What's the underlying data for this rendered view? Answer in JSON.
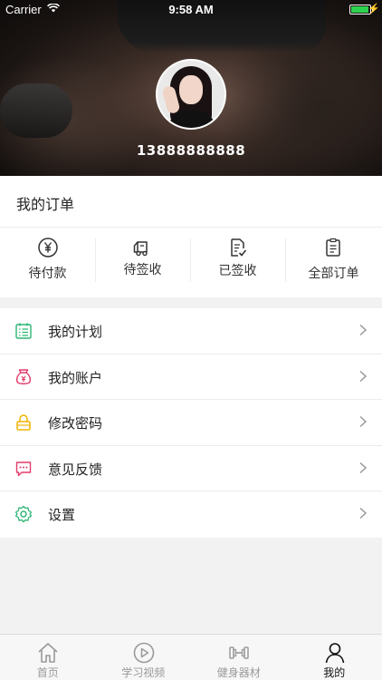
{
  "status_bar": {
    "carrier": "Carrier",
    "time": "9:58 AM"
  },
  "profile": {
    "phone": "13888888888"
  },
  "orders": {
    "title": "我的订单",
    "items": [
      {
        "label": "待付款",
        "icon": "yen-circle-icon"
      },
      {
        "label": "待签收",
        "icon": "delivery-truck-icon"
      },
      {
        "label": "已签收",
        "icon": "signed-document-icon"
      },
      {
        "label": "全部订单",
        "icon": "clipboard-list-icon"
      }
    ]
  },
  "menu": [
    {
      "label": "我的计划",
      "icon": "plan-list-icon",
      "color": "#2bb673"
    },
    {
      "label": "我的账户",
      "icon": "money-bag-icon",
      "color": "#e23c6b"
    },
    {
      "label": "修改密码",
      "icon": "lock-icon",
      "color": "#f0b400"
    },
    {
      "label": "意见反馈",
      "icon": "chat-bubble-icon",
      "color": "#e23c6b"
    },
    {
      "label": "设置",
      "icon": "gear-icon",
      "color": "#2bb673"
    }
  ],
  "tabbar": {
    "active": 3,
    "tabs": [
      {
        "label": "首页",
        "icon": "home-icon"
      },
      {
        "label": "学习视频",
        "icon": "play-circle-icon"
      },
      {
        "label": "健身器材",
        "icon": "dumbbell-icon"
      },
      {
        "label": "我的",
        "icon": "person-icon"
      }
    ]
  },
  "colors": {
    "tab_active": "#111111",
    "tab_inactive": "#9a9a9a",
    "battery": "#2ed14e"
  }
}
